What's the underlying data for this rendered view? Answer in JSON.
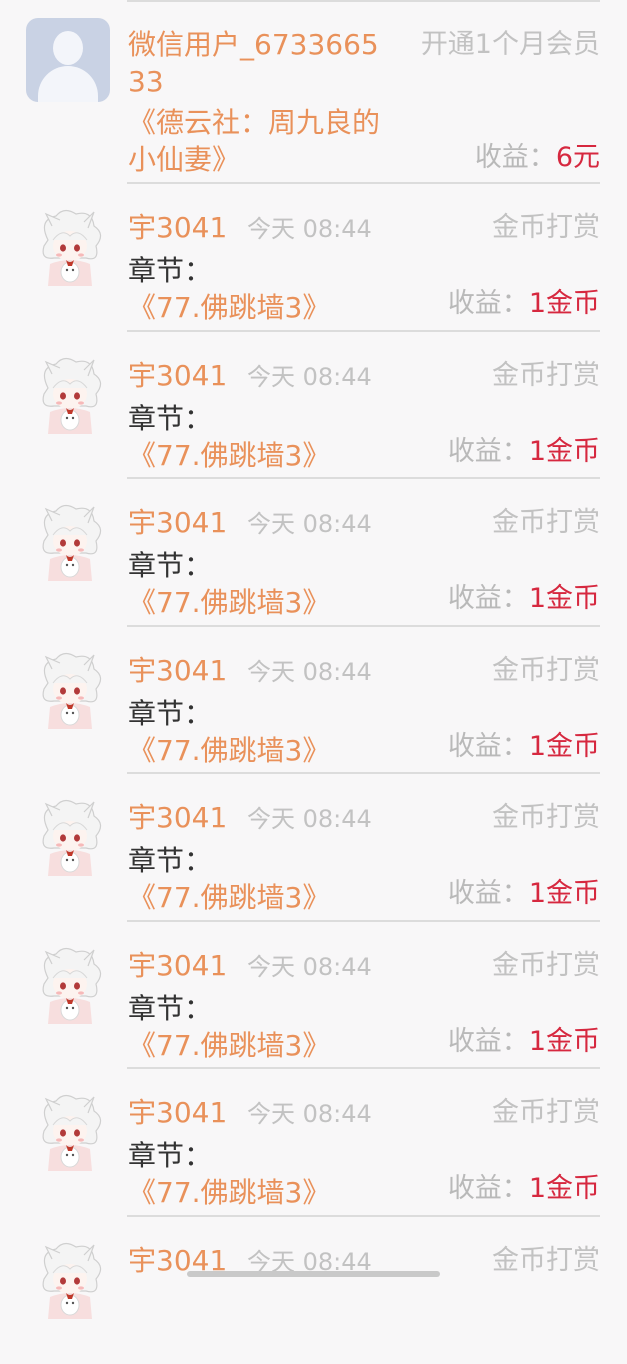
{
  "member_item": {
    "user": "微信用户_673366533",
    "type": "开通1个月会员",
    "book": "《德云社：周九良的小仙妻》",
    "income_label": "收益：",
    "income_value": "6元"
  },
  "rewards": [
    {
      "user": "宇3041",
      "time": "今天 08:44",
      "type": "金币打赏",
      "chapter_label": "章节：",
      "chapter": "《77.佛跳墙3》",
      "income_label": "收益：",
      "income_value": "1金币"
    },
    {
      "user": "宇3041",
      "time": "今天 08:44",
      "type": "金币打赏",
      "chapter_label": "章节：",
      "chapter": "《77.佛跳墙3》",
      "income_label": "收益：",
      "income_value": "1金币"
    },
    {
      "user": "宇3041",
      "time": "今天 08:44",
      "type": "金币打赏",
      "chapter_label": "章节：",
      "chapter": "《77.佛跳墙3》",
      "income_label": "收益：",
      "income_value": "1金币"
    },
    {
      "user": "宇3041",
      "time": "今天 08:44",
      "type": "金币打赏",
      "chapter_label": "章节：",
      "chapter": "《77.佛跳墙3》",
      "income_label": "收益：",
      "income_value": "1金币"
    },
    {
      "user": "宇3041",
      "time": "今天 08:44",
      "type": "金币打赏",
      "chapter_label": "章节：",
      "chapter": "《77.佛跳墙3》",
      "income_label": "收益：",
      "income_value": "1金币"
    },
    {
      "user": "宇3041",
      "time": "今天 08:44",
      "type": "金币打赏",
      "chapter_label": "章节：",
      "chapter": "《77.佛跳墙3》",
      "income_label": "收益：",
      "income_value": "1金币"
    },
    {
      "user": "宇3041",
      "time": "今天 08:44",
      "type": "金币打赏",
      "chapter_label": "章节：",
      "chapter": "《77.佛跳墙3》",
      "income_label": "收益：",
      "income_value": "1金币"
    },
    {
      "user": "宇3041",
      "time": "今天 08:44",
      "type": "金币打赏",
      "chapter_label": "",
      "chapter": "",
      "income_label": "",
      "income_value": ""
    }
  ],
  "colors": {
    "accent_orange": "#e9915a",
    "income_red": "#d6283f",
    "muted_gray": "#c2c2c2",
    "background": "#f8f7f8"
  },
  "icons": {
    "default_avatar": "default-user-avatar-icon",
    "reward_avatar": "anime-character-avatar"
  }
}
